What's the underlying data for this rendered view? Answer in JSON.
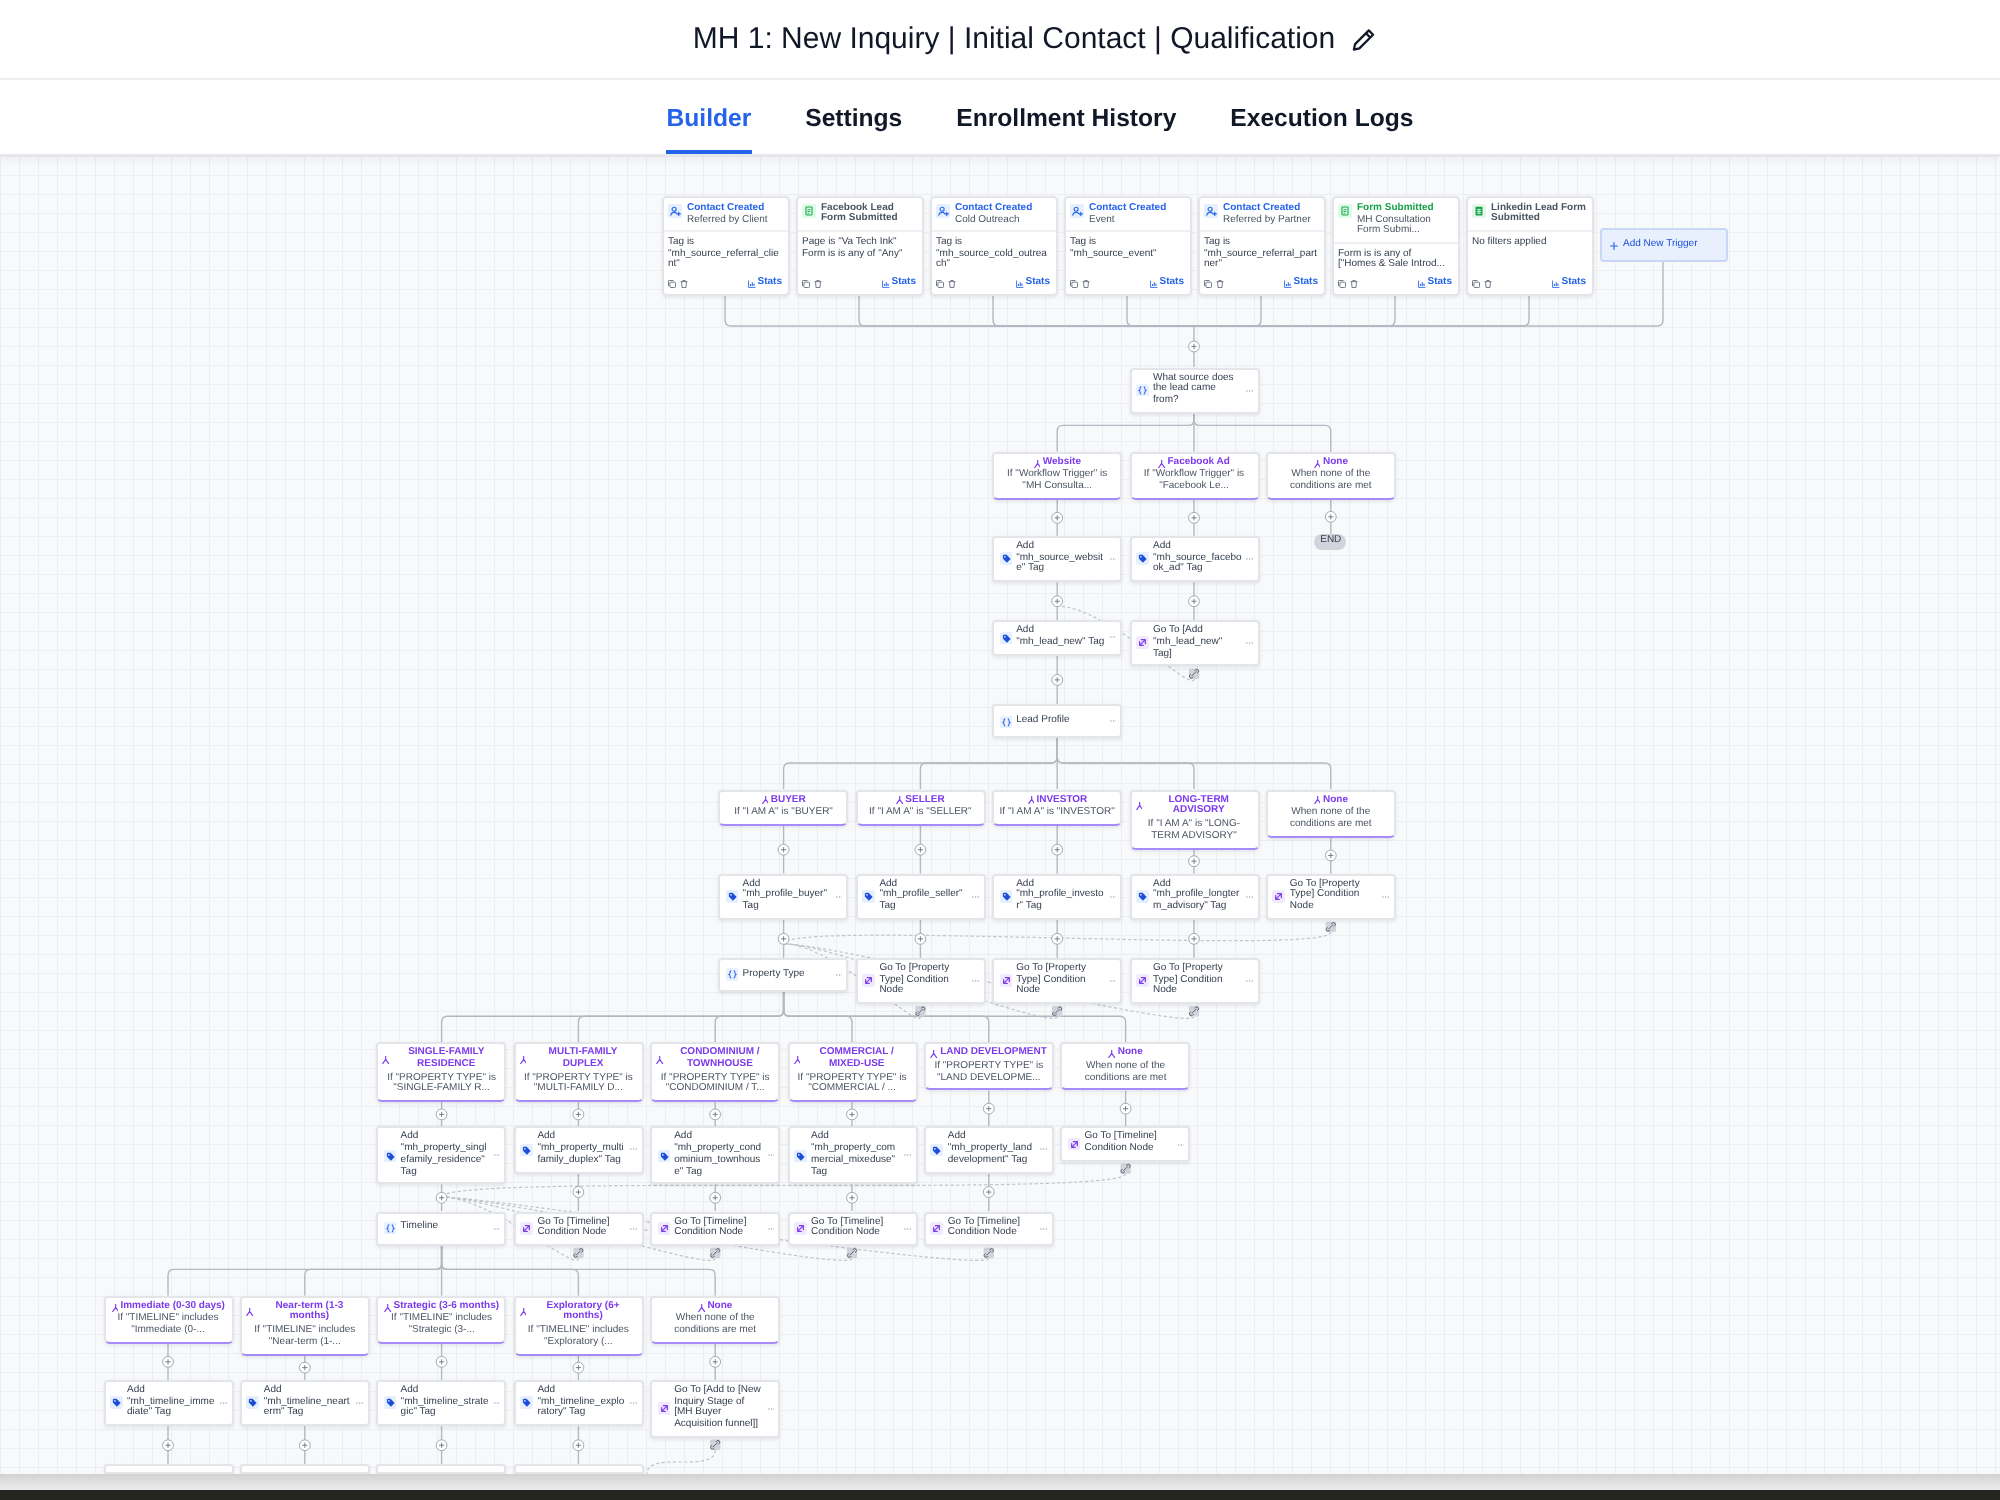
{
  "header": {
    "title": "MH 1: New Inquiry | Initial Contact | Qualification"
  },
  "tabs": [
    {
      "label": "Builder",
      "selected": true
    },
    {
      "label": "Settings",
      "selected": false
    },
    {
      "label": "Enrollment History",
      "selected": false
    },
    {
      "label": "Execution Logs",
      "selected": false
    }
  ],
  "triggers": [
    {
      "kind": "contact",
      "title": "Contact Created",
      "subtitle": "Referred by Client",
      "filters": [
        "Tag is \"mh_source_referral_client\""
      ],
      "stats": "Stats"
    },
    {
      "kind": "facebook_form",
      "title": "Facebook Lead Form Submitted",
      "filters": [
        "Page is \"Va Tech Ink\"",
        "Form is is any of \"Any\""
      ],
      "stats": "Stats"
    },
    {
      "kind": "contact",
      "title": "Contact Created",
      "subtitle": "Cold Outreach",
      "filters": [
        "Tag is \"mh_source_cold_outreach\""
      ],
      "stats": "Stats"
    },
    {
      "kind": "contact",
      "title": "Contact Created",
      "subtitle": "Event",
      "filters": [
        "Tag is \"mh_source_event\""
      ],
      "stats": "Stats"
    },
    {
      "kind": "contact",
      "title": "Contact Created",
      "subtitle": "Referred by Partner",
      "filters": [
        "Tag is \"mh_source_referral_partner\""
      ],
      "stats": "Stats"
    },
    {
      "kind": "form",
      "title": "Form Submitted",
      "subtitle": "MH Consultation Form Submi...",
      "filters": [
        "Form is is any of [\"Homes & Sale Introd..."
      ],
      "stats": "Stats"
    },
    {
      "kind": "linkedin_form",
      "title": "Linkedin Lead Form Submitted",
      "filters": [
        "No filters applied"
      ],
      "stats": "Stats"
    }
  ],
  "add_trigger": {
    "label": "Add New Trigger"
  },
  "flow": [
    {
      "condition": "What source does the lead came from?",
      "branches": [
        {
          "name": "Website",
          "rule": "If \"Workflow Trigger\" is \"MH Consulta...",
          "steps": [
            {
              "kind": "tag",
              "text": "Add \"mh_source_website\" Tag"
            },
            {
              "kind": "tag",
              "text": "Add \"mh_lead_new\" Tag"
            }
          ]
        },
        {
          "name": "Facebook Ad",
          "rule": "If \"Workflow Trigger\" is \"Facebook Le...",
          "steps": [
            {
              "kind": "tag",
              "text": "Add \"mh_source_facebook_ad\" Tag"
            },
            {
              "kind": "goto",
              "text": "Go To [Add \"mh_lead_new\" Tag]"
            }
          ]
        },
        {
          "name": "None",
          "rule": "When none of the conditions are met",
          "steps": [
            {
              "kind": "end",
              "text": "END"
            }
          ]
        }
      ]
    },
    {
      "condition": "Lead Profile",
      "branches": [
        {
          "name": "BUYER",
          "rule": "If \"I AM A\" is \"BUYER\"",
          "steps": [
            {
              "kind": "tag",
              "text": "Add \"mh_profile_buyer\" Tag"
            }
          ]
        },
        {
          "name": "SELLER",
          "rule": "If \"I AM A\" is \"SELLER\"",
          "steps": [
            {
              "kind": "tag",
              "text": "Add \"mh_profile_seller\" Tag"
            },
            {
              "kind": "goto",
              "text": "Go To [Property Type] Condition Node"
            }
          ]
        },
        {
          "name": "INVESTOR",
          "rule": "If \"I AM A\" is \"INVESTOR\"",
          "steps": [
            {
              "kind": "tag",
              "text": "Add \"mh_profile_investor\" Tag"
            },
            {
              "kind": "goto",
              "text": "Go To [Property Type] Condition Node"
            }
          ]
        },
        {
          "name": "LONG-TERM ADVISORY",
          "rule": "If \"I AM A\" is \"LONG-TERM ADVISORY\"",
          "steps": [
            {
              "kind": "tag",
              "text": "Add \"mh_profile_longterm_advisory\" Tag"
            },
            {
              "kind": "goto",
              "text": "Go To [Property Type] Condition Node"
            }
          ]
        },
        {
          "name": "None",
          "rule": "When none of the conditions are met",
          "steps": [
            {
              "kind": "goto",
              "text": "Go To [Property Type] Condition Node"
            }
          ]
        }
      ]
    },
    {
      "condition": "Property Type",
      "branches": [
        {
          "name": "SINGLE-FAMILY RESIDENCE",
          "rule": "If \"PROPERTY TYPE\" is \"SINGLE-FAMILY R...",
          "steps": [
            {
              "kind": "tag",
              "text": "Add \"mh_property_singlefamily_residence\" Tag"
            }
          ]
        },
        {
          "name": "MULTI-FAMILY DUPLEX",
          "rule": "If \"PROPERTY TYPE\" is \"MULTI-FAMILY D...",
          "steps": [
            {
              "kind": "tag",
              "text": "Add \"mh_property_multifamily_duplex\" Tag"
            },
            {
              "kind": "goto",
              "text": "Go To [Timeline] Condition Node"
            }
          ]
        },
        {
          "name": "CONDOMINIUM / TOWNHOUSE",
          "rule": "If \"PROPERTY TYPE\" is \"CONDOMINIUM / T...",
          "steps": [
            {
              "kind": "tag",
              "text": "Add \"mh_property_condominium_townhouse\" Tag"
            },
            {
              "kind": "goto",
              "text": "Go To [Timeline] Condition Node"
            }
          ]
        },
        {
          "name": "COMMERCIAL / MIXED-USE",
          "rule": "If \"PROPERTY TYPE\" is \"COMMERCIAL / ...",
          "steps": [
            {
              "kind": "tag",
              "text": "Add \"mh_property_commercial_mixeduse\" Tag"
            },
            {
              "kind": "goto",
              "text": "Go To [Timeline] Condition Node"
            }
          ]
        },
        {
          "name": "LAND DEVELOPMENT",
          "rule": "If \"PROPERTY TYPE\" is \"LAND DEVELOPME...",
          "steps": [
            {
              "kind": "tag",
              "text": "Add \"mh_property_landdevelopment\" Tag"
            },
            {
              "kind": "goto",
              "text": "Go To [Timeline] Condition Node"
            }
          ]
        },
        {
          "name": "None",
          "rule": "When none of the conditions are met",
          "steps": [
            {
              "kind": "goto",
              "text": "Go To [Timeline] Condition Node"
            }
          ]
        }
      ]
    },
    {
      "condition": "Timeline",
      "branches": [
        {
          "name": "Immediate (0-30 days)",
          "rule": "If \"TIMELINE\" includes \"Immediate (0-...",
          "steps": [
            {
              "kind": "tag",
              "text": "Add \"mh_timeline_immediate\" Tag"
            },
            {
              "kind": "clipped"
            }
          ]
        },
        {
          "name": "Near-term (1-3 months)",
          "rule": "If \"TIMELINE\" includes \"Near-term (1-...",
          "steps": [
            {
              "kind": "tag",
              "text": "Add \"mh_timeline_nearterm\" Tag"
            },
            {
              "kind": "clipped"
            }
          ]
        },
        {
          "name": "Strategic (3-6 months)",
          "rule": "If \"TIMELINE\" includes \"Strategic (3-...",
          "steps": [
            {
              "kind": "tag",
              "text": "Add \"mh_timeline_strategic\" Tag"
            },
            {
              "kind": "clipped"
            }
          ]
        },
        {
          "name": "Exploratory (6+ months)",
          "rule": "If \"TIMELINE\" includes \"Exploratory (...",
          "steps": [
            {
              "kind": "tag",
              "text": "Add \"mh_timeline_exploratory\" Tag"
            },
            {
              "kind": "clipped"
            }
          ]
        },
        {
          "name": "None",
          "rule": "When none of the conditions are met",
          "steps": [
            {
              "kind": "goto",
              "text": "Go To [Add to [New Inquiry Stage of [MH Buyer Acquisition funnel]]"
            }
          ]
        }
      ]
    }
  ]
}
